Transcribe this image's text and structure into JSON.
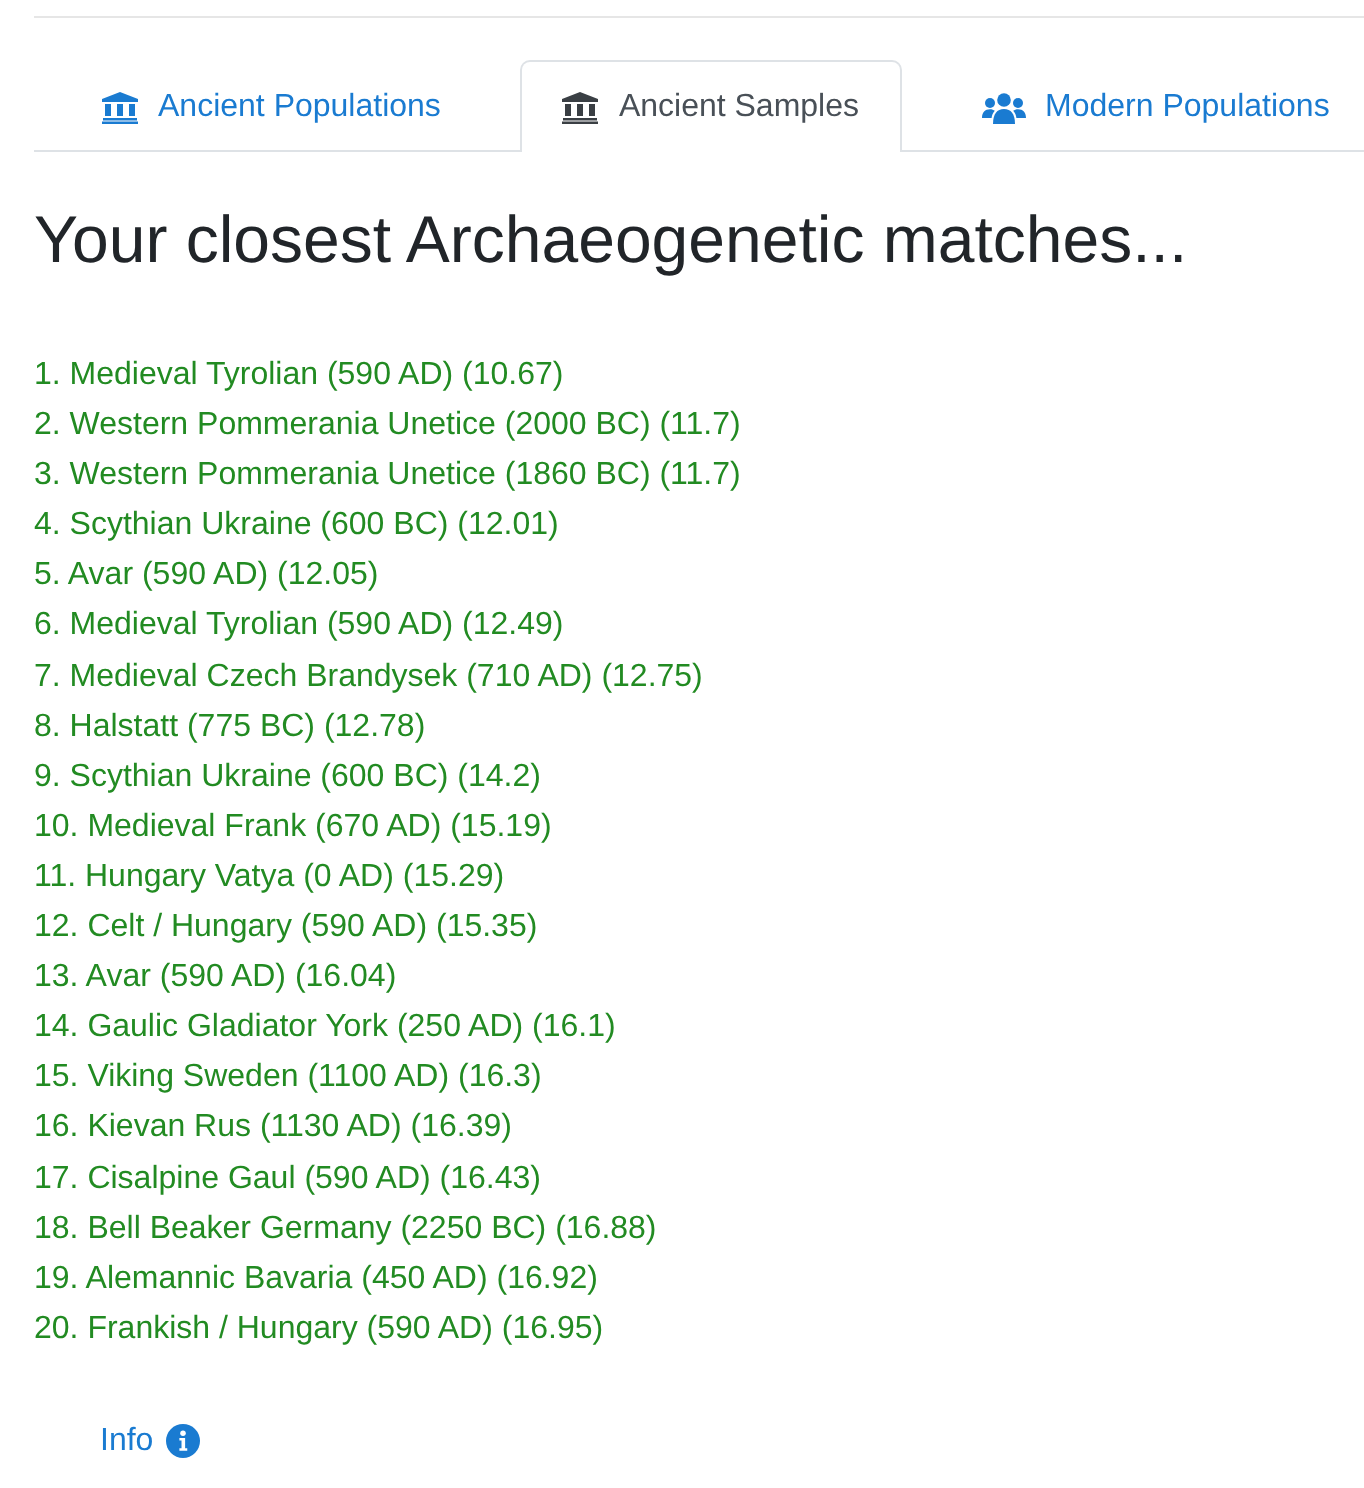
{
  "tabs": [
    {
      "label": "Ancient Populations",
      "selected": false
    },
    {
      "label": "Ancient Samples",
      "selected": true
    },
    {
      "label": "Modern Populations",
      "selected": false
    }
  ],
  "heading": "Your closest Archaeogenetic matches...",
  "matches": [
    "1. Medieval Tyrolian (590 AD) (10.67)",
    "2. Western Pommerania Unetice (2000 BC) (11.7)",
    "3. Western Pommerania Unetice (1860 BC) (11.7)",
    "4. Scythian Ukraine (600 BC) (12.01)",
    "5. Avar (590 AD) (12.05)",
    "6. Medieval Tyrolian (590 AD) (12.49)",
    "7. Medieval Czech Brandysek (710 AD) (12.75)",
    "8. Halstatt (775 BC) (12.78)",
    "9. Scythian Ukraine (600 BC) (14.2)",
    "10. Medieval Frank (670 AD) (15.19)",
    "11. Hungary Vatya (0 AD) (15.29)",
    "12. Celt / Hungary (590 AD) (15.35)",
    "13. Avar (590 AD) (16.04)",
    "14. Gaulic Gladiator York (250 AD) (16.1)",
    "15. Viking Sweden (1100 AD) (16.3)",
    "16. Kievan Rus (1130 AD) (16.39)",
    "17. Cisalpine Gaul (590 AD) (16.43)",
    "18. Bell Beaker Germany (2250 BC) (16.88)",
    "19. Alemannic Bavaria (450 AD) (16.92)",
    "20. Frankish / Hungary (590 AD) (16.95)"
  ],
  "info_link": {
    "label": "Info"
  }
}
